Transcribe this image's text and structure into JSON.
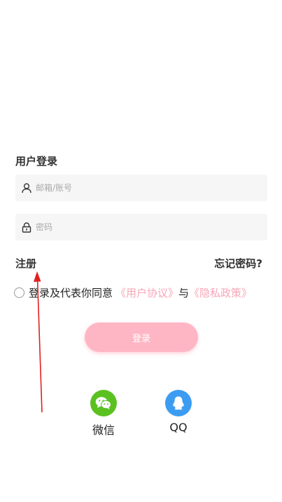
{
  "login": {
    "title": "用户登录",
    "email_placeholder": "邮箱/账号",
    "password_placeholder": "密码",
    "register_label": "注册",
    "forgot_label": "忘记密码?",
    "agree_text": "登录及代表你同意",
    "user_agreement": "《用户协议》",
    "and_text": "与",
    "privacy_policy": "《隐私政策》",
    "login_button": "登录"
  },
  "social": {
    "wechat_label": "微信",
    "qq_label": "QQ"
  },
  "colors": {
    "accent_pink": "#ffb6c4",
    "link_pink": "#f7a6b6",
    "wechat_green": "#5ac121",
    "qq_blue": "#3c9cf2",
    "annotation_red": "#e02020"
  },
  "icons": {
    "user_field": "user-icon",
    "password_field": "lock-icon",
    "wechat": "wechat-icon",
    "qq": "qq-icon"
  }
}
